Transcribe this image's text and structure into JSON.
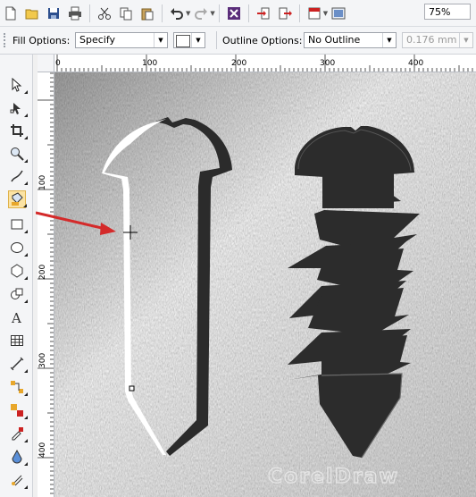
{
  "toolbar": {
    "buttons": [
      {
        "name": "new-document-icon"
      },
      {
        "name": "open-folder-icon"
      },
      {
        "name": "save-icon"
      },
      {
        "name": "print-icon"
      },
      {
        "name": "cut-icon"
      },
      {
        "name": "copy-icon"
      },
      {
        "name": "paste-icon"
      },
      {
        "name": "undo-icon"
      },
      {
        "name": "redo-icon"
      },
      {
        "name": "corel-connect-icon"
      },
      {
        "name": "import-icon"
      },
      {
        "name": "export-icon"
      },
      {
        "name": "publish-pdf-icon"
      },
      {
        "name": "application-launcher-icon"
      }
    ],
    "zoom": "75%"
  },
  "property_bar": {
    "fill_options_label": "Fill Options:",
    "fill_type": "Specify",
    "outline_options_label": "Outline Options:",
    "outline_type": "No Outline",
    "outline_width": "0.176 mm"
  },
  "rulers": {
    "horizontal": [
      "0",
      "100",
      "200",
      "300",
      "400"
    ],
    "vertical": [
      "100",
      "200",
      "300",
      "400"
    ]
  },
  "toolbox": {
    "active_tool": "smart-fill-tool",
    "tools": [
      "pick-tool",
      "shape-tool",
      "crop-tool",
      "zoom-tool",
      "freehand-tool",
      "smart-fill-tool",
      "rectangle-tool",
      "ellipse-tool",
      "polygon-tool",
      "basic-shapes-tool",
      "text-tool",
      "table-tool",
      "dimension-tool",
      "connector-tool",
      "blend-tool",
      "eyedropper-tool",
      "interactive-fill-tool",
      "mesh-fill-tool"
    ]
  },
  "colors": {
    "arrow": "#d42a2a",
    "screw_fill": "#2b2b2b",
    "metal_bg": "#a9a9a9"
  },
  "watermark": "CorelDraw"
}
